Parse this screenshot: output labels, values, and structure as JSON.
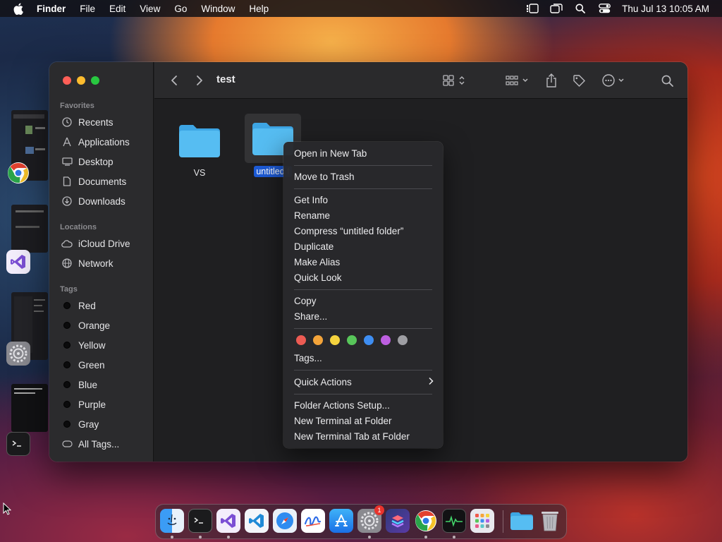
{
  "menubar": {
    "app_name": "Finder",
    "menus": [
      "File",
      "Edit",
      "View",
      "Go",
      "Window",
      "Help"
    ],
    "clock": "Thu Jul 13  10:05 AM",
    "status_icons": [
      "stage-manager-icon",
      "screen-mirroring-icon",
      "spotlight-icon",
      "control-center-icon"
    ]
  },
  "finder": {
    "title": "test",
    "sidebar": {
      "favorites_header": "Favorites",
      "favorites": [
        {
          "label": "Recents",
          "icon": "clock-icon"
        },
        {
          "label": "Applications",
          "icon": "applications-icon"
        },
        {
          "label": "Desktop",
          "icon": "desktop-icon"
        },
        {
          "label": "Documents",
          "icon": "document-icon"
        },
        {
          "label": "Downloads",
          "icon": "download-icon"
        }
      ],
      "locations_header": "Locations",
      "locations": [
        {
          "label": "iCloud Drive",
          "icon": "cloud-icon"
        },
        {
          "label": "Network",
          "icon": "globe-icon"
        }
      ],
      "tags_header": "Tags",
      "tags": [
        "Red",
        "Orange",
        "Yellow",
        "Green",
        "Blue",
        "Purple",
        "Gray"
      ],
      "all_tags": "All Tags..."
    },
    "items": [
      {
        "label": "VS",
        "selected": false
      },
      {
        "label": "untitled f",
        "selected": true
      }
    ]
  },
  "context_menu": {
    "items": {
      "open_new_tab": "Open in New Tab",
      "move_to_trash": "Move to Trash",
      "get_info": "Get Info",
      "rename": "Rename",
      "compress": "Compress “untitled folder”",
      "duplicate": "Duplicate",
      "make_alias": "Make Alias",
      "quick_look": "Quick Look",
      "copy": "Copy",
      "share": "Share...",
      "tags": "Tags...",
      "quick_actions": "Quick Actions",
      "folder_actions_setup": "Folder Actions Setup...",
      "new_terminal": "New Terminal at Folder",
      "new_terminal_tab": "New Terminal Tab at Folder"
    },
    "tag_colors": [
      "#ec5b53",
      "#f3a43a",
      "#f5d33e",
      "#58c65a",
      "#3e8ef2",
      "#bd5fe0",
      "#9e9ea3"
    ]
  },
  "dock": {
    "apps": [
      "finder",
      "terminal",
      "visual-studio",
      "vscode",
      "safari",
      "freeform",
      "app-store",
      "system-settings",
      "shortcuts",
      "chrome",
      "activity-monitor",
      "launchpad"
    ],
    "settings_badge": "1"
  }
}
